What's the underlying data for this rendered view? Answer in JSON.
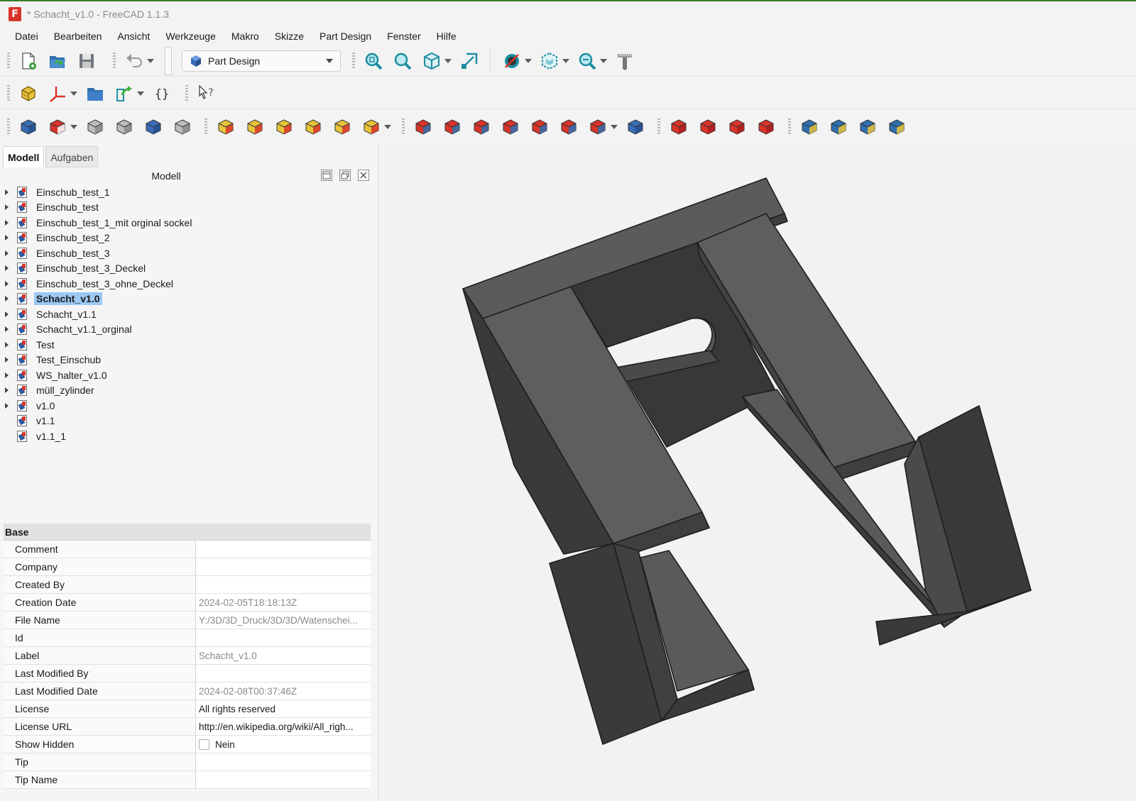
{
  "window": {
    "title": "* Schacht_v1.0 - FreeCAD 1.1.3",
    "logo_letter": "F"
  },
  "menu": [
    {
      "label": "Datei"
    },
    {
      "label": "Bearbeiten"
    },
    {
      "label": "Ansicht"
    },
    {
      "label": "Werkzeuge"
    },
    {
      "label": "Makro"
    },
    {
      "label": "Skizze"
    },
    {
      "label": "Part Design"
    },
    {
      "label": "Fenster"
    },
    {
      "label": "Hilfe"
    }
  ],
  "workbench": {
    "selected": "Part Design"
  },
  "toolbar_icons": {
    "row1": [
      "new-document-icon",
      "open-document-icon",
      "save-icon",
      "undo-icon",
      "fit-all-icon",
      "fit-selection-icon",
      "isometric-view-icon",
      "align-to-selection-icon",
      "draw-style-icon",
      "bounding-box-icon",
      "zoom-icon",
      "measure-icon"
    ],
    "row2": [
      "part-icon",
      "coordinate-system-icon",
      "group-folder-icon",
      "link-icon",
      "variable-set-icon",
      "whats-this-icon"
    ],
    "row3": [
      "body-icon",
      "sketch-icon",
      "validate-sketch-icon",
      "shape-binder-icon",
      "subshape-binder-icon",
      "clone-icon",
      "pad-icon",
      "revolution-icon",
      "additive-loft-icon",
      "additive-pipe-icon",
      "additive-helix-icon",
      "additive-primitive-icon",
      "pocket-icon",
      "hole-icon",
      "groove-icon",
      "subtractive-loft-icon",
      "subtractive-pipe-icon",
      "subtractive-helix-icon",
      "subtractive-primitive-icon",
      "boolean-icon",
      "fillet-icon",
      "chamfer-icon",
      "draft-icon",
      "thickness-icon",
      "mirrored-icon",
      "linear-pattern-icon",
      "polar-pattern-icon",
      "multi-transform-icon"
    ]
  },
  "panel": {
    "tabs": [
      {
        "label": "Modell",
        "active": true
      },
      {
        "label": "Aufgaben",
        "active": false
      }
    ],
    "tree_title": "Modell"
  },
  "tree": [
    {
      "label": "Einschub_test_1",
      "expandable": true
    },
    {
      "label": "Einschub_test",
      "expandable": true
    },
    {
      "label": "Einschub_test_1_mit orginal sockel",
      "expandable": true
    },
    {
      "label": "Einschub_test_2",
      "expandable": true
    },
    {
      "label": "Einschub_test_3",
      "expandable": true
    },
    {
      "label": "Einschub_test_3_Deckel",
      "expandable": true
    },
    {
      "label": "Einschub_test_3_ohne_Deckel",
      "expandable": true
    },
    {
      "label": "Schacht_v1.0",
      "expandable": true,
      "selected": true
    },
    {
      "label": "Schacht_v1.1",
      "expandable": true
    },
    {
      "label": "Schacht_v1.1_orginal",
      "expandable": true
    },
    {
      "label": "Test",
      "expandable": true
    },
    {
      "label": "Test_Einschub",
      "expandable": true
    },
    {
      "label": "WS_halter_v1.0",
      "expandable": true
    },
    {
      "label": "müll_zylinder",
      "expandable": true
    },
    {
      "label": "v1.0",
      "expandable": true
    },
    {
      "label": "v1.1",
      "expandable": false
    },
    {
      "label": "v1.1_1",
      "expandable": false
    }
  ],
  "properties": {
    "group": "Base",
    "rows": [
      {
        "name": "Comment",
        "value": ""
      },
      {
        "name": "Company",
        "value": ""
      },
      {
        "name": "Created By",
        "value": ""
      },
      {
        "name": "Creation Date",
        "value": "2024-02-05T18:18:13Z",
        "dim": true
      },
      {
        "name": "File Name",
        "value": "Y:/3D/3D_Druck/3D/3D/Watenschei...",
        "dim": true
      },
      {
        "name": "Id",
        "value": ""
      },
      {
        "name": "Label",
        "value": "Schacht_v1.0",
        "dim": true
      },
      {
        "name": "Last Modified By",
        "value": ""
      },
      {
        "name": "Last Modified Date",
        "value": "2024-02-08T00:37:46Z",
        "dim": true
      },
      {
        "name": "License",
        "value": "All rights reserved"
      },
      {
        "name": "License URL",
        "value": "http://en.wikipedia.org/wiki/All_righ..."
      },
      {
        "name": "Show Hidden",
        "value": "Nein",
        "checkbox": true
      },
      {
        "name": "Tip",
        "value": ""
      },
      {
        "name": "Tip Name",
        "value": ""
      }
    ]
  },
  "colors": {
    "selection": "#9cc8f3",
    "model_top": "#5a5a5a",
    "model_side": "#404040",
    "model_dark": "#2f2f2f",
    "viewport_bg": "#f2f2f2"
  }
}
